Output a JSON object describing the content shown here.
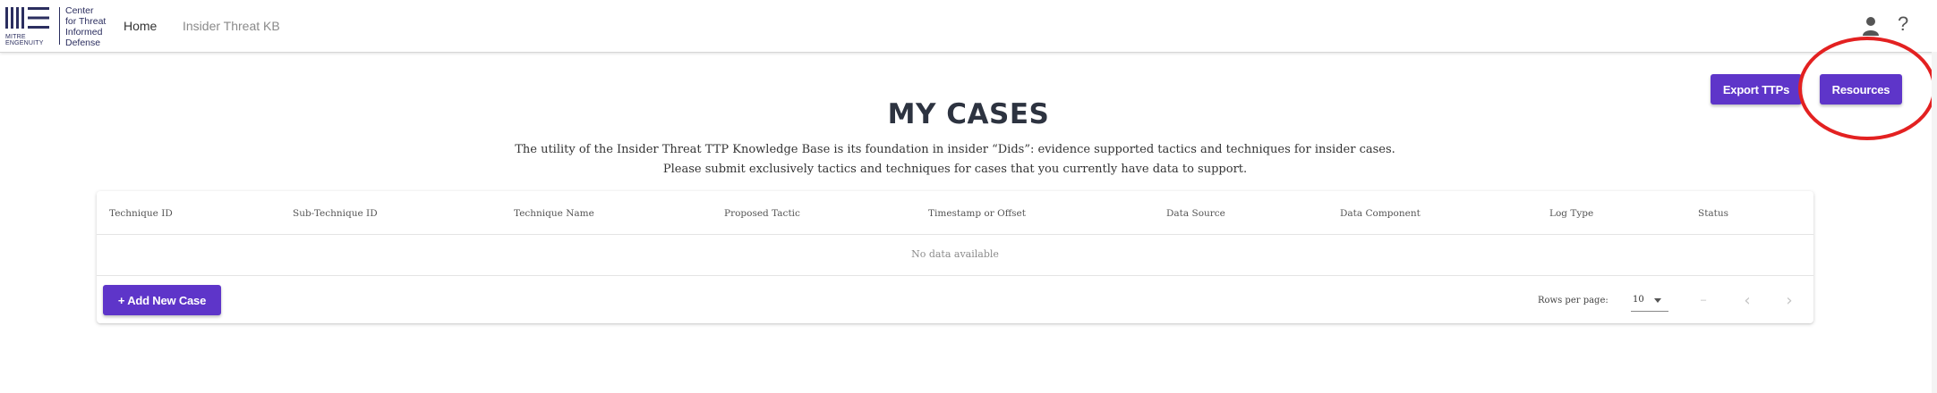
{
  "header": {
    "logo": {
      "mitre": "MITRE",
      "engenuity": "ENGENUITY"
    },
    "ctid_lines": [
      "Center",
      "for Threat",
      "Informed",
      "Defense"
    ],
    "nav": [
      {
        "label": "Home"
      },
      {
        "label": "Insider Threat KB"
      }
    ],
    "icons": {
      "user": "user-icon",
      "help": "?"
    }
  },
  "actions": {
    "export_label": "Export TTPs",
    "resources_label": "Resources"
  },
  "annotation": {
    "color": "#e32121",
    "target": "Resources"
  },
  "main": {
    "title": "MY CASES",
    "subtitle_line1": "The utility of the Insider Threat TTP Knowledge Base is its foundation in insider “Dids”: evidence supported tactics and techniques for insider cases.",
    "subtitle_line2": "Please submit exclusively tactics and techniques for cases that you currently have data to support."
  },
  "table": {
    "columns": [
      "Technique ID",
      "Sub-Technique ID",
      "Technique Name",
      "Proposed Tactic",
      "Timestamp or Offset",
      "Data Source",
      "Data Component",
      "Log Type",
      "Status"
    ],
    "rows": [],
    "empty_text": "No data available"
  },
  "footer": {
    "add_label": "+ Add New Case",
    "rows_per_page_label": "Rows per page:",
    "rows_per_page_value": "10",
    "range_text": "–"
  },
  "colors": {
    "accent": "#5e35c9",
    "title": "#2d3340"
  }
}
